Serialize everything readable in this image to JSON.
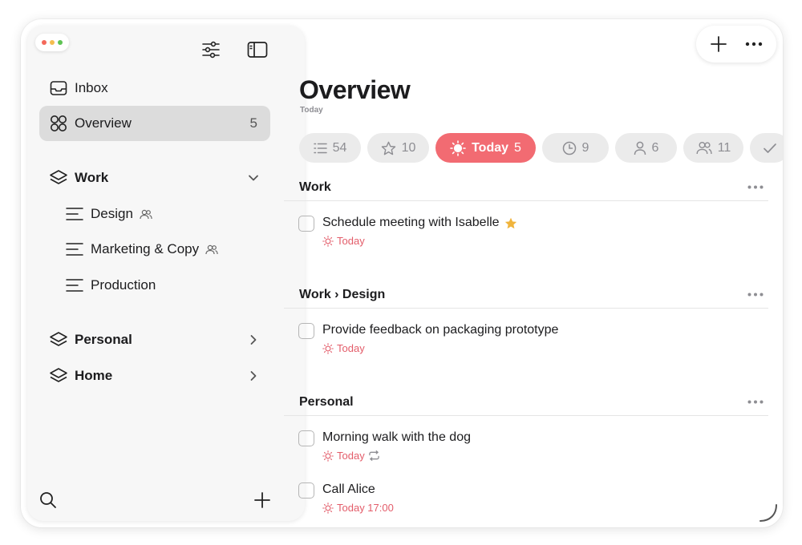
{
  "sidebar": {
    "inbox": {
      "label": "Inbox"
    },
    "overview": {
      "label": "Overview",
      "count": "5"
    },
    "groups": [
      {
        "label": "Work",
        "expanded": true,
        "items": [
          {
            "label": "Design",
            "shared": true
          },
          {
            "label": "Marketing & Copy",
            "shared": true
          },
          {
            "label": "Production",
            "shared": false
          }
        ]
      },
      {
        "label": "Personal",
        "expanded": false
      },
      {
        "label": "Home",
        "expanded": false
      }
    ]
  },
  "main": {
    "title": "Overview",
    "subtitle": "Today",
    "filters": [
      {
        "icon": "list-icon",
        "label": "",
        "count": "54"
      },
      {
        "icon": "star-icon",
        "label": "",
        "count": "10"
      },
      {
        "icon": "sun-icon",
        "label": "Today",
        "count": "5",
        "active": true
      },
      {
        "icon": "clock-icon",
        "label": "",
        "count": "9"
      },
      {
        "icon": "person-icon",
        "label": "",
        "count": "6"
      },
      {
        "icon": "people-icon",
        "label": "",
        "count": "11"
      },
      {
        "icon": "checkmark-icon",
        "label": "",
        "count": ""
      }
    ],
    "sections": [
      {
        "title": "Work",
        "tasks": [
          {
            "title": "Schedule meeting with Isabelle",
            "starred": true,
            "due": "Today"
          }
        ]
      },
      {
        "title": "Work › Design",
        "tasks": [
          {
            "title": "Provide feedback on packaging prototype",
            "due": "Today"
          }
        ]
      },
      {
        "title": "Personal",
        "tasks": [
          {
            "title": "Morning walk with the dog",
            "due": "Today",
            "repeats": true
          },
          {
            "title": "Call Alice",
            "due": "Today 17:00"
          }
        ]
      }
    ]
  },
  "colors": {
    "accent": "#f26b72",
    "due_text": "#e35d6a",
    "star": "#f0b43c"
  }
}
